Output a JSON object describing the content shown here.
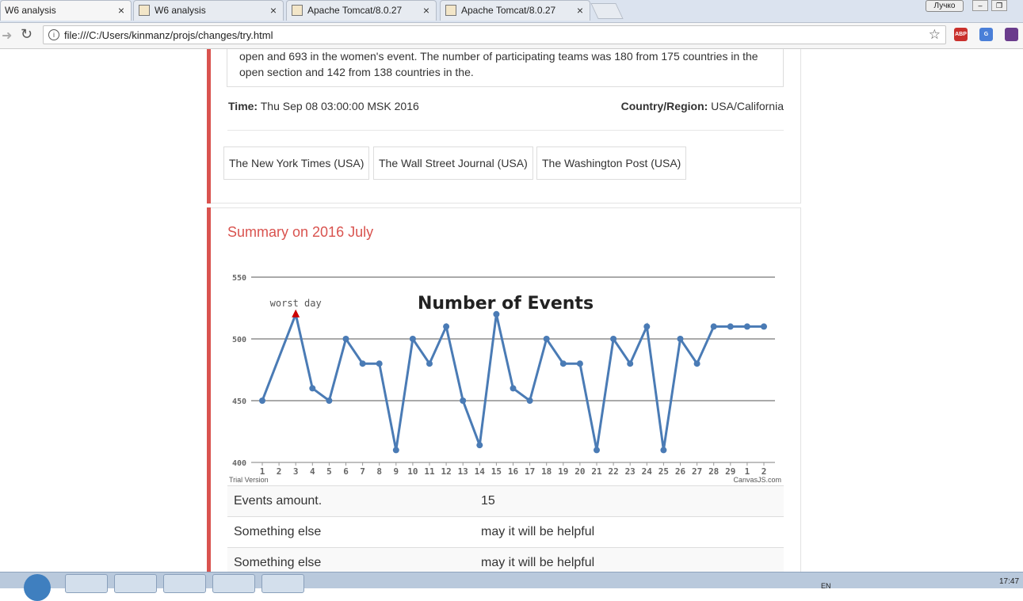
{
  "browser": {
    "tabs": [
      {
        "title": "W6 analysis",
        "active": true
      },
      {
        "title": "W6 analysis",
        "active": false
      },
      {
        "title": "Apache Tomcat/8.0.27 - ",
        "active": false
      },
      {
        "title": "Apache Tomcat/8.0.27 - ",
        "active": false
      }
    ],
    "close_glyph": "×",
    "user_label": "Лучко",
    "url": "file:///C:/Users/kinmanz/projs/changes/try.html",
    "extensions": [
      {
        "name": "adblock-icon",
        "label": "ABP",
        "color": "#c9302c"
      },
      {
        "name": "translate-icon",
        "label": "G",
        "color": "#4a7fd8"
      },
      {
        "name": "extension-icon",
        "label": "",
        "color": "#6a3c8c"
      }
    ]
  },
  "event": {
    "description": "open and 693 in the women's event. The number of participating teams was 180 from 175 countries in the open section and 142 from 138 countries in the.",
    "time_label": "Time:",
    "time_value": "Thu Sep 08 03:00:00 MSK 2016",
    "region_label": "Country/Region:",
    "region_value": "USA/California",
    "sources": [
      "The New York Times (USA)",
      "The Wall Street Journal (USA)",
      "The Washington Post (USA)"
    ]
  },
  "summary": {
    "title": "Summary on 2016 July",
    "rows": [
      {
        "label": "Events amount.",
        "value": "15"
      },
      {
        "label": "Something else",
        "value": "may it will be helpful"
      },
      {
        "label": "Something else",
        "value": "may it will be helpful"
      }
    ]
  },
  "chart_data": {
    "type": "line",
    "title": "Number of Events",
    "x": [
      "1",
      "2",
      "3",
      "4",
      "5",
      "6",
      "7",
      "8",
      "9",
      "10",
      "11",
      "12",
      "13",
      "14",
      "15",
      "16",
      "17",
      "18",
      "19",
      "20",
      "21",
      "22",
      "23",
      "24",
      "25",
      "26",
      "27",
      "28",
      "29",
      "1",
      "2"
    ],
    "values": [
      450,
      null,
      520,
      460,
      450,
      500,
      480,
      480,
      410,
      500,
      480,
      510,
      450,
      414,
      520,
      460,
      450,
      500,
      480,
      480,
      410,
      500,
      480,
      510,
      410,
      500,
      480,
      510,
      510,
      510,
      510
    ],
    "ylim": [
      400,
      550
    ],
    "yticks": [
      400,
      450,
      500,
      550
    ],
    "annotation": {
      "label": "worst day",
      "index": 2
    },
    "line_color": "#4a7bb5",
    "marker_color": "#cc0000",
    "watermark_left": "Trial Version",
    "watermark_right": "CanvasJS.com"
  },
  "taskbar": {
    "lang": "EN",
    "clock": "17:47"
  }
}
